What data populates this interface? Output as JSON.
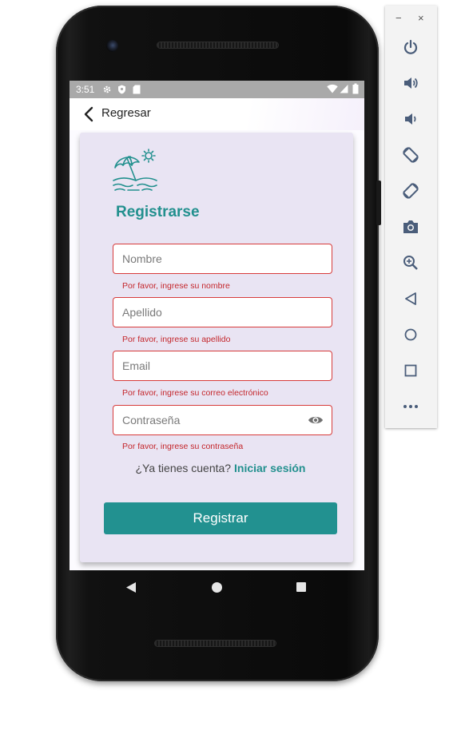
{
  "statusbar": {
    "time": "3:51"
  },
  "app_bar": {
    "back_label": "Regresar"
  },
  "form": {
    "title": "Registrarse",
    "fields": [
      {
        "placeholder": "Nombre",
        "error": "Por favor, ingrese su nombre"
      },
      {
        "placeholder": "Apellido",
        "error": "Por favor, ingrese su apellido"
      },
      {
        "placeholder": "Email",
        "error": "Por favor, ingrese su correo electrónico"
      },
      {
        "placeholder": "Contraseña",
        "error": "Por favor, ingrese su contraseña"
      }
    ],
    "login_prompt": "¿Ya tienes cuenta?",
    "login_link": "Iniciar sesión",
    "submit_label": "Registrar"
  },
  "emulator_toolbar": {
    "minimize": "−",
    "close": "×",
    "icons": [
      "power-icon",
      "volume-up-icon",
      "volume-down-icon",
      "rotate-left-icon",
      "rotate-right-icon",
      "camera-icon",
      "zoom-icon",
      "back-icon",
      "home-icon",
      "overview-icon",
      "more-icon"
    ]
  },
  "colors": {
    "accent": "#229190",
    "error": "#c4262b",
    "card": "#e9e4f3",
    "statusbar": "#a9a9a9"
  }
}
